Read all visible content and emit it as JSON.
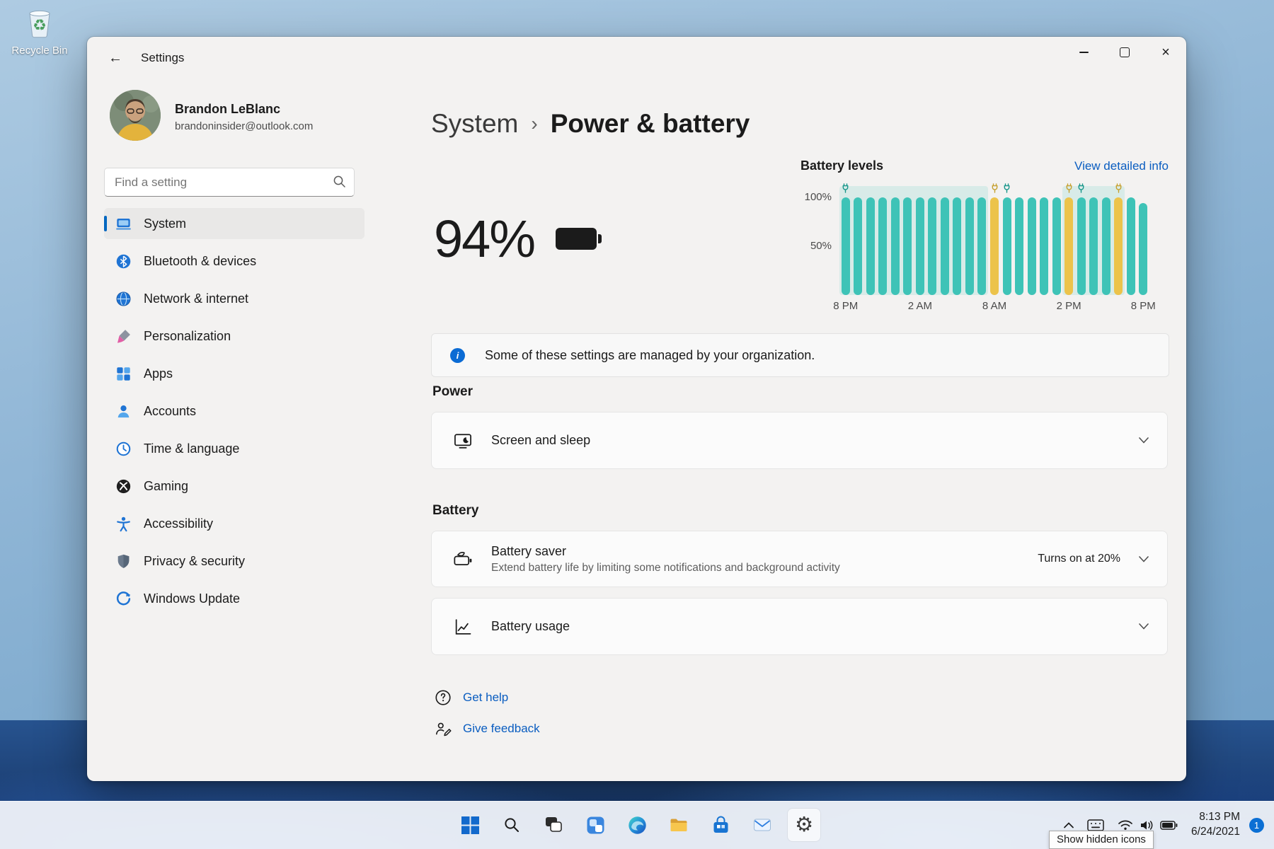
{
  "glyphs": {
    "back": "←",
    "separator": "›",
    "close": "×",
    "info": "i",
    "recycle": "♻",
    "gear": "⚙"
  },
  "desktop": {
    "recycle_bin_label": "Recycle Bin"
  },
  "window": {
    "title": "Settings",
    "profile": {
      "name": "Brandon LeBlanc",
      "email": "brandoninsider@outlook.com"
    },
    "search": {
      "placeholder": "Find a setting"
    },
    "sidebar": {
      "items": [
        {
          "label": "System",
          "selected": true
        },
        {
          "label": "Bluetooth & devices"
        },
        {
          "label": "Network & internet"
        },
        {
          "label": "Personalization"
        },
        {
          "label": "Apps"
        },
        {
          "label": "Accounts"
        },
        {
          "label": "Time & language"
        },
        {
          "label": "Gaming"
        },
        {
          "label": "Accessibility"
        },
        {
          "label": "Privacy & security"
        },
        {
          "label": "Windows Update"
        }
      ]
    },
    "breadcrumb": {
      "parent": "System",
      "current": "Power & battery"
    },
    "battery": {
      "percent": "94%"
    },
    "banner": {
      "text": "Some of these settings are managed by your organization."
    },
    "power_section": {
      "title": "Power",
      "screen_sleep": "Screen and sleep"
    },
    "battery_section": {
      "title": "Battery",
      "saver_title": "Battery saver",
      "saver_desc": "Extend battery life by limiting some notifications and background activity",
      "saver_value": "Turns on at 20%",
      "usage_title": "Battery usage"
    },
    "links": {
      "get_help": "Get help",
      "give_feedback": "Give feedback"
    }
  },
  "chart_data": {
    "type": "bar",
    "title": "Battery levels",
    "link": "View detailed info",
    "ylabel_ticks": [
      "100%",
      "50%"
    ],
    "xlabels": [
      "8 PM",
      "2 AM",
      "8 AM",
      "2 PM",
      "8 PM"
    ],
    "ylim": [
      0,
      100
    ],
    "bar_colors": {
      "teal": "#3ec3b7",
      "yellow": "#ecc34b"
    },
    "marker_colors": {
      "plug-teal": "#17968a",
      "plug-yellow": "#c5a02f"
    },
    "bars": [
      {
        "v": 100,
        "c": "teal",
        "m": "plug-teal"
      },
      {
        "v": 100,
        "c": "teal"
      },
      {
        "v": 100,
        "c": "teal"
      },
      {
        "v": 100,
        "c": "teal"
      },
      {
        "v": 100,
        "c": "teal"
      },
      {
        "v": 100,
        "c": "teal"
      },
      {
        "v": 100,
        "c": "teal"
      },
      {
        "v": 100,
        "c": "teal"
      },
      {
        "v": 100,
        "c": "teal"
      },
      {
        "v": 100,
        "c": "teal"
      },
      {
        "v": 100,
        "c": "teal"
      },
      {
        "v": 100,
        "c": "teal"
      },
      {
        "v": 100,
        "c": "yellow",
        "m": "plug-yellow"
      },
      {
        "v": 100,
        "c": "teal",
        "m": "plug-teal"
      },
      {
        "v": 100,
        "c": "teal"
      },
      {
        "v": 100,
        "c": "teal"
      },
      {
        "v": 100,
        "c": "teal"
      },
      {
        "v": 100,
        "c": "teal"
      },
      {
        "v": 100,
        "c": "yellow",
        "m": "plug-yellow"
      },
      {
        "v": 100,
        "c": "teal",
        "m": "plug-teal"
      },
      {
        "v": 100,
        "c": "teal"
      },
      {
        "v": 100,
        "c": "teal"
      },
      {
        "v": 100,
        "c": "yellow",
        "m": "plug-yellow"
      },
      {
        "v": 100,
        "c": "teal"
      },
      {
        "v": 94,
        "c": "teal"
      }
    ],
    "bands": [
      [
        0,
        11
      ],
      [
        18,
        22
      ]
    ]
  },
  "taskbar": {
    "tooltip": "Show hidden icons",
    "time": "8:13 PM",
    "date": "6/24/2021",
    "badge": "1"
  }
}
